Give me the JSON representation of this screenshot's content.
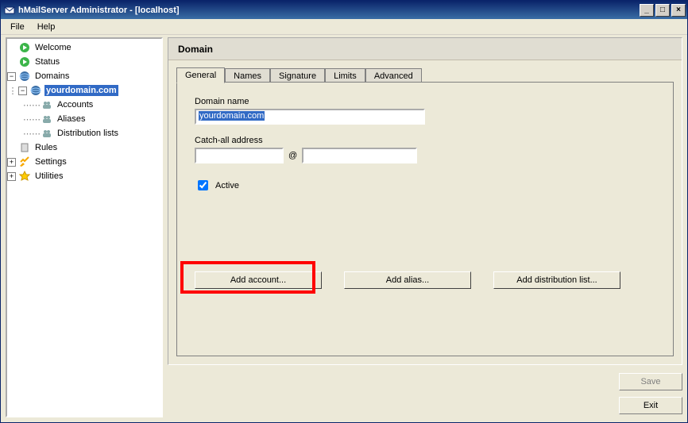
{
  "window": {
    "title": "hMailServer Administrator - [localhost]"
  },
  "menu": {
    "file": "File",
    "help": "Help"
  },
  "tree": {
    "welcome": "Welcome",
    "status": "Status",
    "domains": "Domains",
    "selected_domain": "yourdomain.com",
    "accounts": "Accounts",
    "aliases": "Aliases",
    "distribution_lists": "Distribution lists",
    "rules": "Rules",
    "settings": "Settings",
    "utilities": "Utilities"
  },
  "panel": {
    "title": "Domain",
    "tabs": {
      "general": "General",
      "names": "Names",
      "signature": "Signature",
      "limits": "Limits",
      "advanced": "Advanced"
    }
  },
  "general": {
    "domain_name_label": "Domain name",
    "domain_name_value": "yourdomain.com",
    "catchall_label": "Catch-all address",
    "catchall_local": "",
    "catchall_at": "@",
    "catchall_domain": "",
    "active_label": "Active",
    "active_checked": true
  },
  "buttons": {
    "add_account": "Add account...",
    "add_alias": "Add alias...",
    "add_list": "Add distribution list...",
    "save": "Save",
    "exit": "Exit"
  },
  "win_controls": {
    "min": "_",
    "max": "□",
    "close": "×"
  }
}
